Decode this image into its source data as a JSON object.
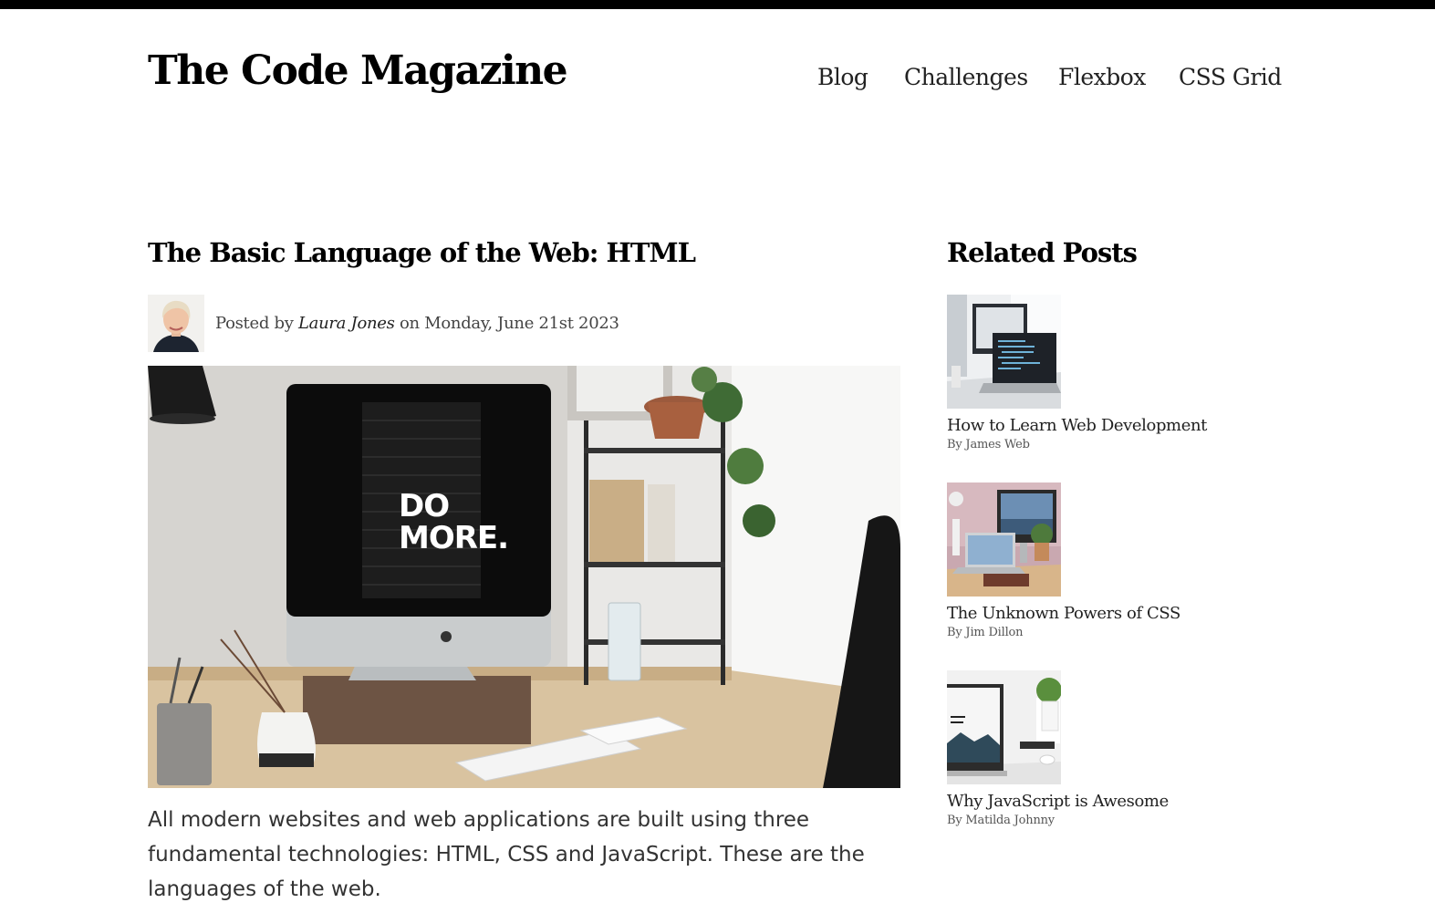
{
  "site": {
    "logo": "The Code Magazine"
  },
  "nav": {
    "items": [
      "Blog",
      "Challenges",
      "Flexbox",
      "CSS Grid"
    ]
  },
  "post": {
    "title": "The Basic Language of the Web: HTML",
    "meta_prefix": "Posted by",
    "author": "Laura Jones",
    "meta_suffix": "on Monday, June 21st 2023",
    "hero_text": [
      "DO",
      "MORE."
    ],
    "intro": "All modern websites and web applications are built using three fundamental technologies: HTML, CSS and JavaScript. These are the languages of the web."
  },
  "related": {
    "title": "Related Posts",
    "items": [
      {
        "title": "How to Learn Web Development",
        "author": "By James Web"
      },
      {
        "title": "The Unknown Powers of CSS",
        "author": "By Jim Dillon"
      },
      {
        "title": "Why JavaScript is Awesome",
        "author": "By Matilda Johnny"
      }
    ]
  }
}
